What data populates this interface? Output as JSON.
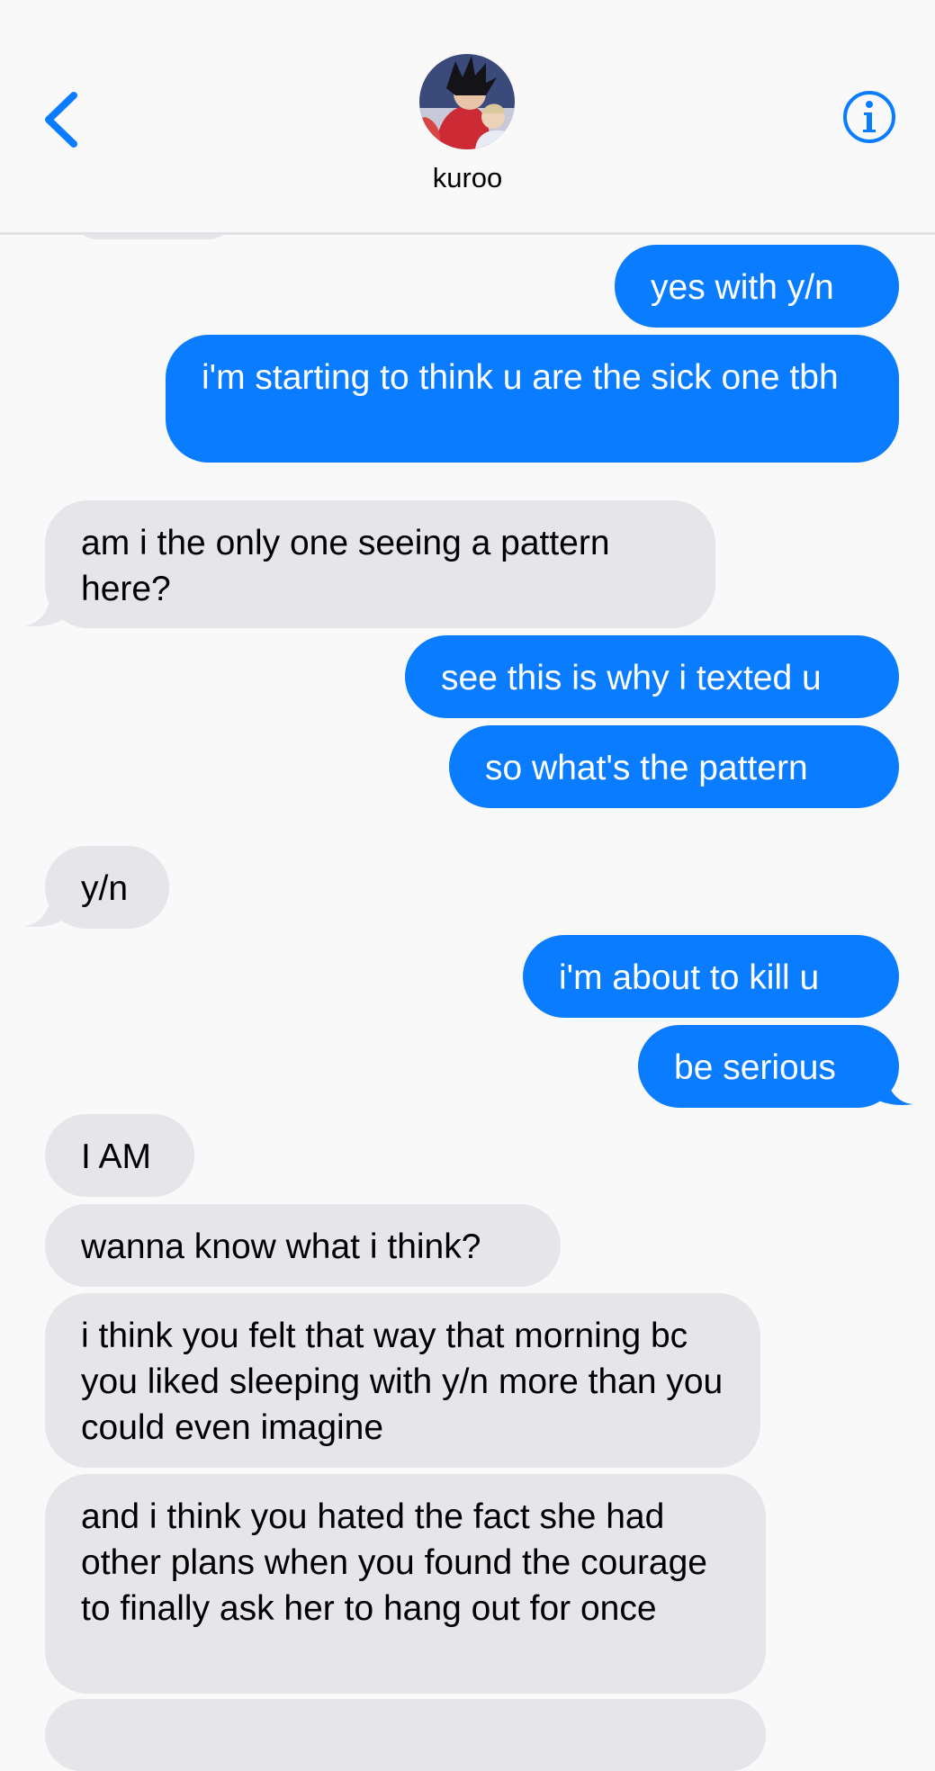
{
  "header": {
    "back_icon": "chevron-left-icon",
    "contact_name": "kuroo",
    "avatar": "contact-avatar",
    "info_icon": "info-icon",
    "accent": "#0a7cff"
  },
  "messages": [
    {
      "from": "me",
      "text": "yes with y/n"
    },
    {
      "from": "me",
      "text": "i'm starting to think u are the sick one tbh"
    },
    {
      "from": "them",
      "text": "am i the only one seeing a pattern here?"
    },
    {
      "from": "me",
      "text": "see this is why i texted u"
    },
    {
      "from": "me",
      "text": "so what's the pattern"
    },
    {
      "from": "them",
      "text": "y/n"
    },
    {
      "from": "me",
      "text": "i'm about to kill u"
    },
    {
      "from": "me",
      "text": "be serious"
    },
    {
      "from": "them",
      "text": "I AM"
    },
    {
      "from": "them",
      "text": "wanna know what i think?"
    },
    {
      "from": "them",
      "text": "i think you felt that way that morning bc you liked sleeping with y/n more than you could even imagine"
    },
    {
      "from": "them",
      "text": "and i think you hated the fact she had other plans when you found the courage to finally ask her to hang out for once"
    }
  ],
  "colors": {
    "sent_bubble": "#0a7cff",
    "received_bubble": "#e5e5ea",
    "background": "#f9f9f9"
  }
}
